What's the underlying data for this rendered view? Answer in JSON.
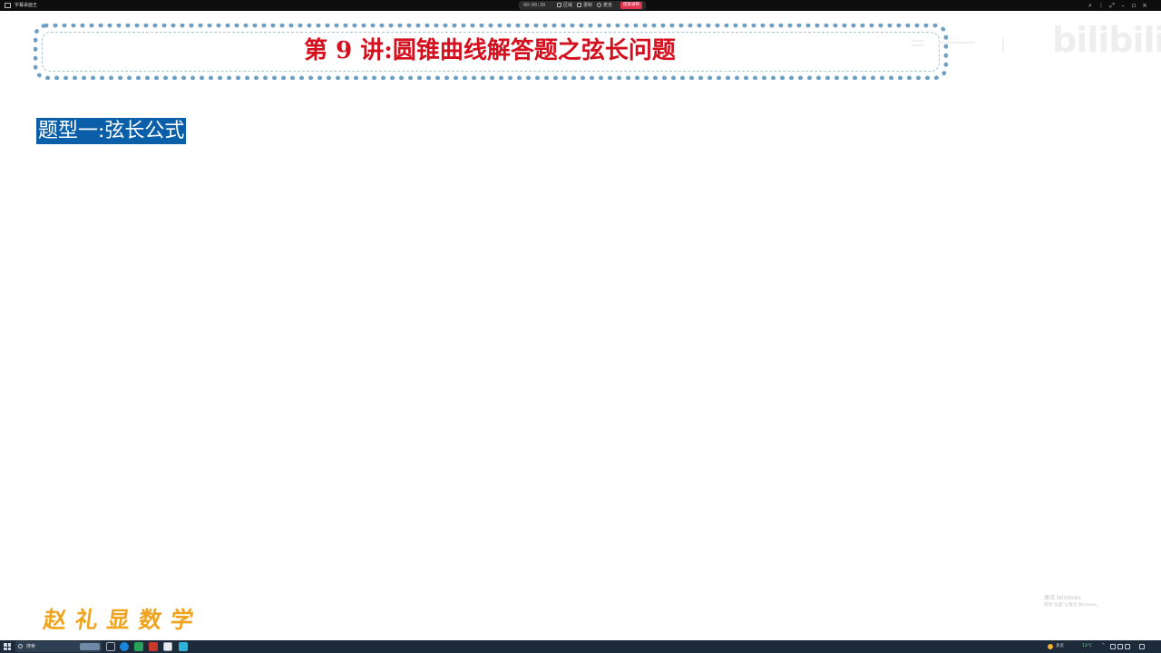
{
  "app": {
    "title": "字幕桌面王"
  },
  "recorder": {
    "timer": "00:00:30",
    "actions": [
      {
        "label": "区域"
      },
      {
        "label": "录制"
      },
      {
        "label": "麦克"
      }
    ],
    "end_label": "结束录制"
  },
  "slide": {
    "title": "第 9 讲:圆锥曲线解答题之弦长问题",
    "section_heading": "题型一:弦长公式",
    "brand": "赵礼显数学"
  },
  "watermark": {
    "brand": "bilibili"
  },
  "activation": {
    "title": "激活 Windows",
    "subtitle": "转到“设置”以激活 Windows。"
  },
  "taskbar": {
    "search_placeholder": "搜索",
    "weather": "多云",
    "temperature": "13°C",
    "time": "",
    "colors": {
      "background": "#1c2a3a"
    }
  },
  "colors": {
    "title_red": "#d4101f",
    "heading_bg": "#0a5fa8",
    "brand_orange": "#f0a41e",
    "banner_border": "#6fa0c4"
  }
}
